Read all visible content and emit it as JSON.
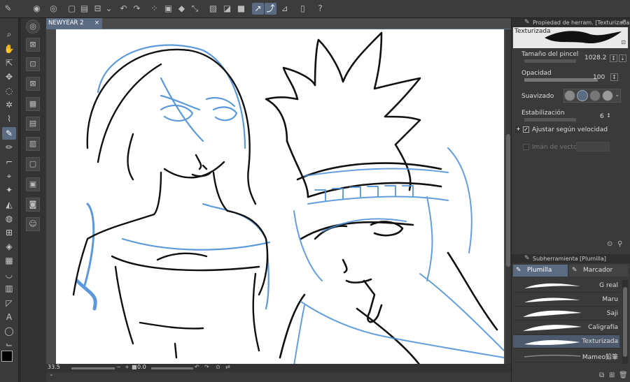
{
  "document": {
    "tab_label": "NEWYEAR 2",
    "tab_close": "×"
  },
  "status": {
    "zoom": "33.5",
    "rotation": "0.0"
  },
  "tool_property": {
    "panel_title": "Propiedad de herram. [Texturizada]",
    "preview_label": "Texturizada",
    "brush_size_label": "Tamaño del pincel",
    "brush_size_value": "1028.2",
    "opacity_label": "Opacidad",
    "opacity_value": "100",
    "smoothing_label": "Suavizado",
    "stabilization_label": "Estabilización",
    "stabilization_value": "6",
    "speed_label": "Ajustar según velocidad",
    "vector_magnet_label": "Imán de vectores"
  },
  "subtool": {
    "panel_title": "Subherramienta [Plumilla]",
    "tabs": [
      "Plumilla",
      "Marcador"
    ],
    "brushes": [
      "G real",
      "Maru",
      "Saji",
      "Caligrafía",
      "Texturizada",
      "Mameo鉛筆"
    ],
    "selected_brush": "Texturizada"
  },
  "colors": {
    "accent": "#5a6b82",
    "sketch_blue": "#4a8fd8",
    "foreground": "#000000",
    "background": "#ffffff"
  },
  "icons": {
    "top": [
      "app-icon",
      "new-icon",
      "open-icon",
      "save-icon",
      "undo-icon",
      "redo-icon",
      "clear-icon",
      "fill-icon",
      "transform-icon",
      "deselect-icon",
      "snap-ruler-icon",
      "snap-special-icon",
      "snap-grid-icon",
      "companion-icon",
      "help-icon"
    ],
    "tools": [
      "zoom-icon",
      "hand-icon",
      "operation-icon",
      "move-layer-icon",
      "lasso-icon",
      "magic-wand-icon",
      "eyedropper-icon",
      "pen-icon",
      "pencil-icon",
      "brush-icon",
      "airbrush-icon",
      "decoration-icon",
      "eraser-icon",
      "blend-icon",
      "fill-icon",
      "gradient-icon",
      "figure-icon",
      "frame-icon",
      "ruler-icon",
      "text-icon",
      "balloon-icon",
      "correction-icon"
    ]
  }
}
